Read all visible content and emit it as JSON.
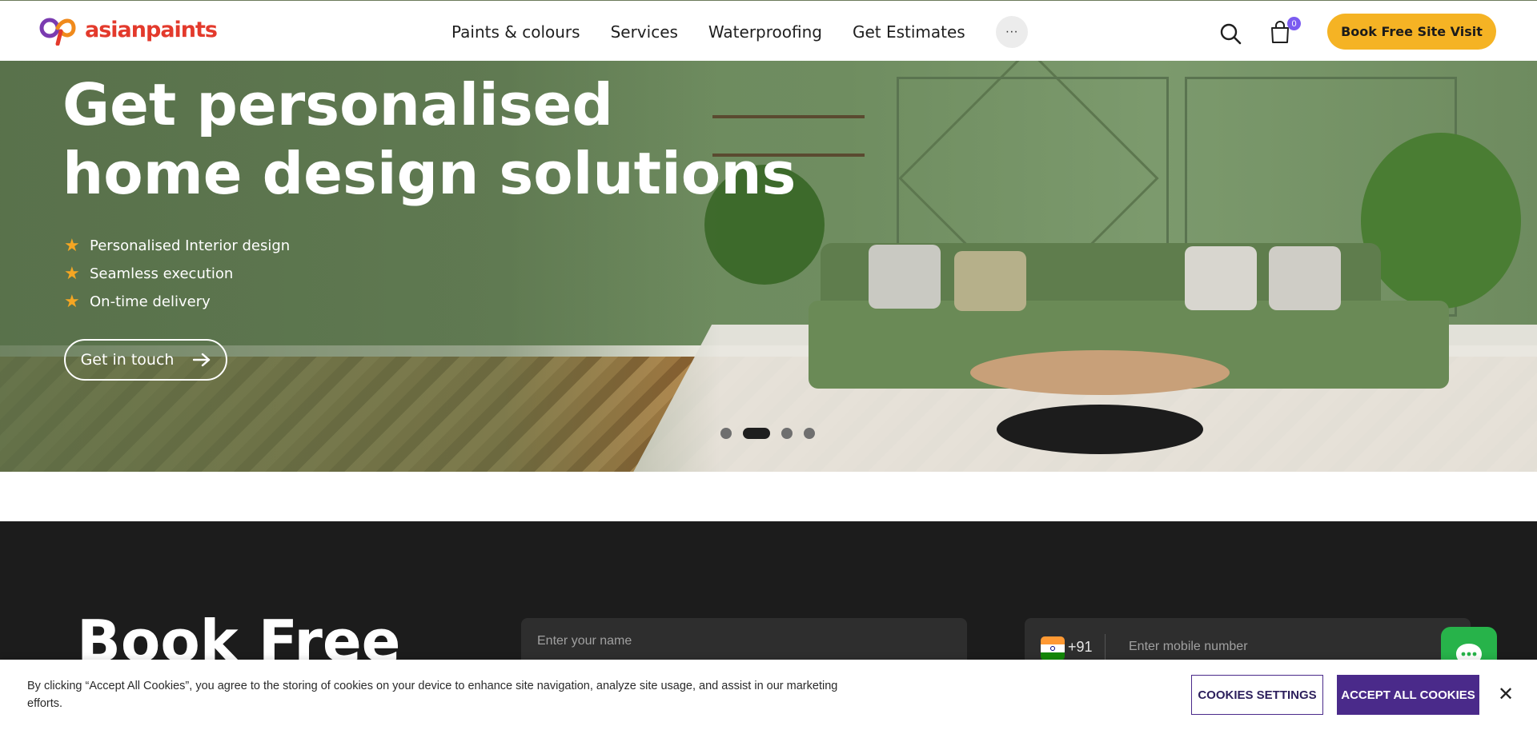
{
  "brand": {
    "name": "asianpaints",
    "color": "#e33a2c"
  },
  "nav": {
    "items": [
      {
        "label": "Paints & colours"
      },
      {
        "label": "Services"
      },
      {
        "label": "Waterproofing"
      },
      {
        "label": "Get Estimates"
      }
    ],
    "more_label": "···"
  },
  "header": {
    "search_icon": "search-icon",
    "cart_icon": "shopping-bag-icon",
    "cart_count": "0",
    "book_button": "Book Free Site Visit"
  },
  "hero": {
    "title_line1": "Get personalised",
    "title_line2": "home design solutions",
    "features": [
      {
        "icon": "star-icon",
        "label": "Personalised Interior design"
      },
      {
        "icon": "star-icon",
        "label": "Seamless execution"
      },
      {
        "icon": "star-icon",
        "label": "On-time delivery"
      }
    ],
    "cta_label": "Get in touch",
    "carousel": {
      "slides": 4,
      "active": 2
    }
  },
  "booking": {
    "title": "Book Free",
    "name_placeholder": "Enter your name",
    "dial_code": "+91",
    "phone_placeholder": "Enter mobile number"
  },
  "cookies": {
    "text": "By clicking “Accept All Cookies”, you agree to the storing of cookies on your device to enhance site navigation, analyze site usage, and assist in our marketing efforts.",
    "settings_label": "COOKIES SETTINGS",
    "accept_label": "ACCEPT ALL COOKIES",
    "close_label": "✕"
  },
  "colors": {
    "accent_yellow": "#f5b324",
    "cookie_purple": "#4a2a8a",
    "chat_green": "#27b34a",
    "dark_section": "#1c1c1c"
  }
}
